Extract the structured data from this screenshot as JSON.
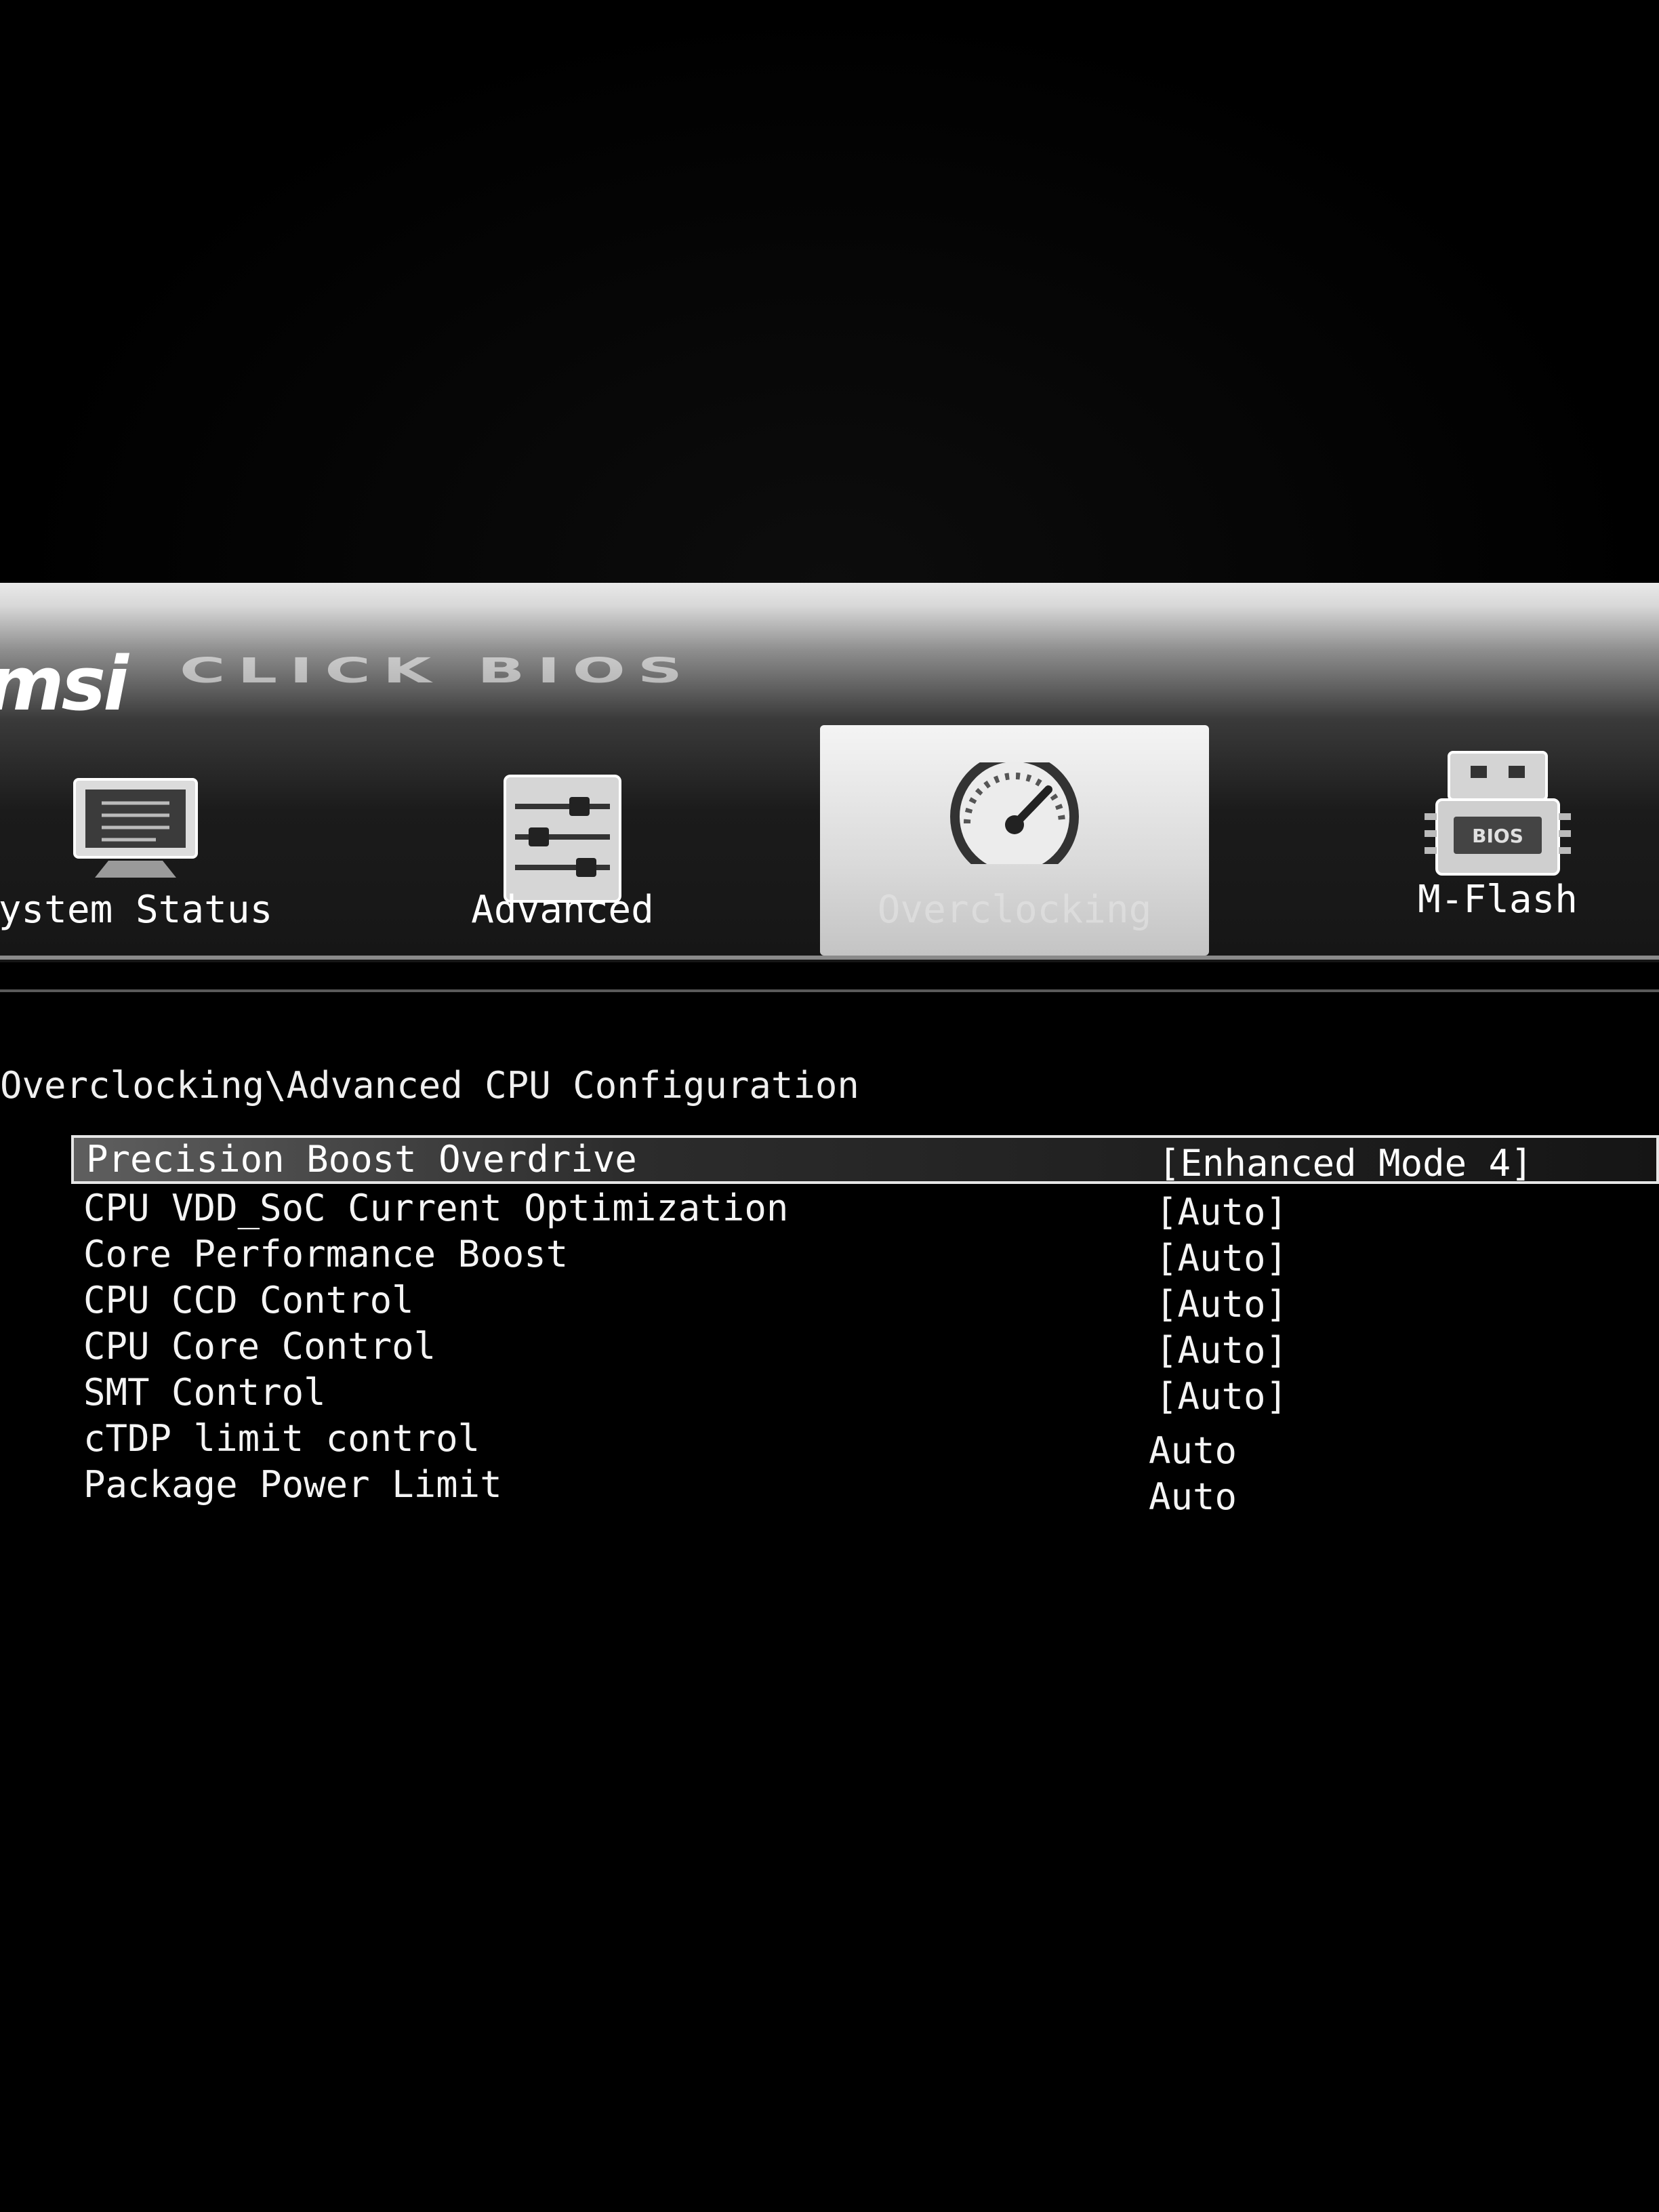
{
  "header": {
    "logo": "msi",
    "product": "CLICK BIOS"
  },
  "tabs": [
    {
      "label": "ystem Status",
      "icon": "monitor-icon"
    },
    {
      "label": "Advanced",
      "icon": "sliders-icon"
    },
    {
      "label": "Overclocking",
      "icon": "speedometer-icon",
      "active": true
    },
    {
      "label": "M-Flash",
      "icon": "bios-chip-icon"
    }
  ],
  "breadcrumb": "Overclocking\\Advanced CPU Configuration",
  "menu": {
    "items": [
      {
        "label": "Precision Boost Overdrive",
        "value": "[Enhanced Mode 4]",
        "selected": true
      },
      {
        "label": "CPU VDD_SoC Current Optimization",
        "value": "[Auto]"
      },
      {
        "label": "Core Performance Boost",
        "value": "[Auto]"
      },
      {
        "label": "CPU CCD Control",
        "value": "[Auto]"
      },
      {
        "label": "CPU Core Control",
        "value": "[Auto]"
      },
      {
        "label": "SMT Control",
        "value": "[Auto]"
      },
      {
        "label": "cTDP limit control",
        "value": "Auto"
      },
      {
        "label": "Package Power Limit",
        "value": "Auto"
      }
    ]
  },
  "colors": {
    "background": "#000000",
    "text": "#f2f2f2",
    "highlight_border": "#e6e6e6"
  }
}
